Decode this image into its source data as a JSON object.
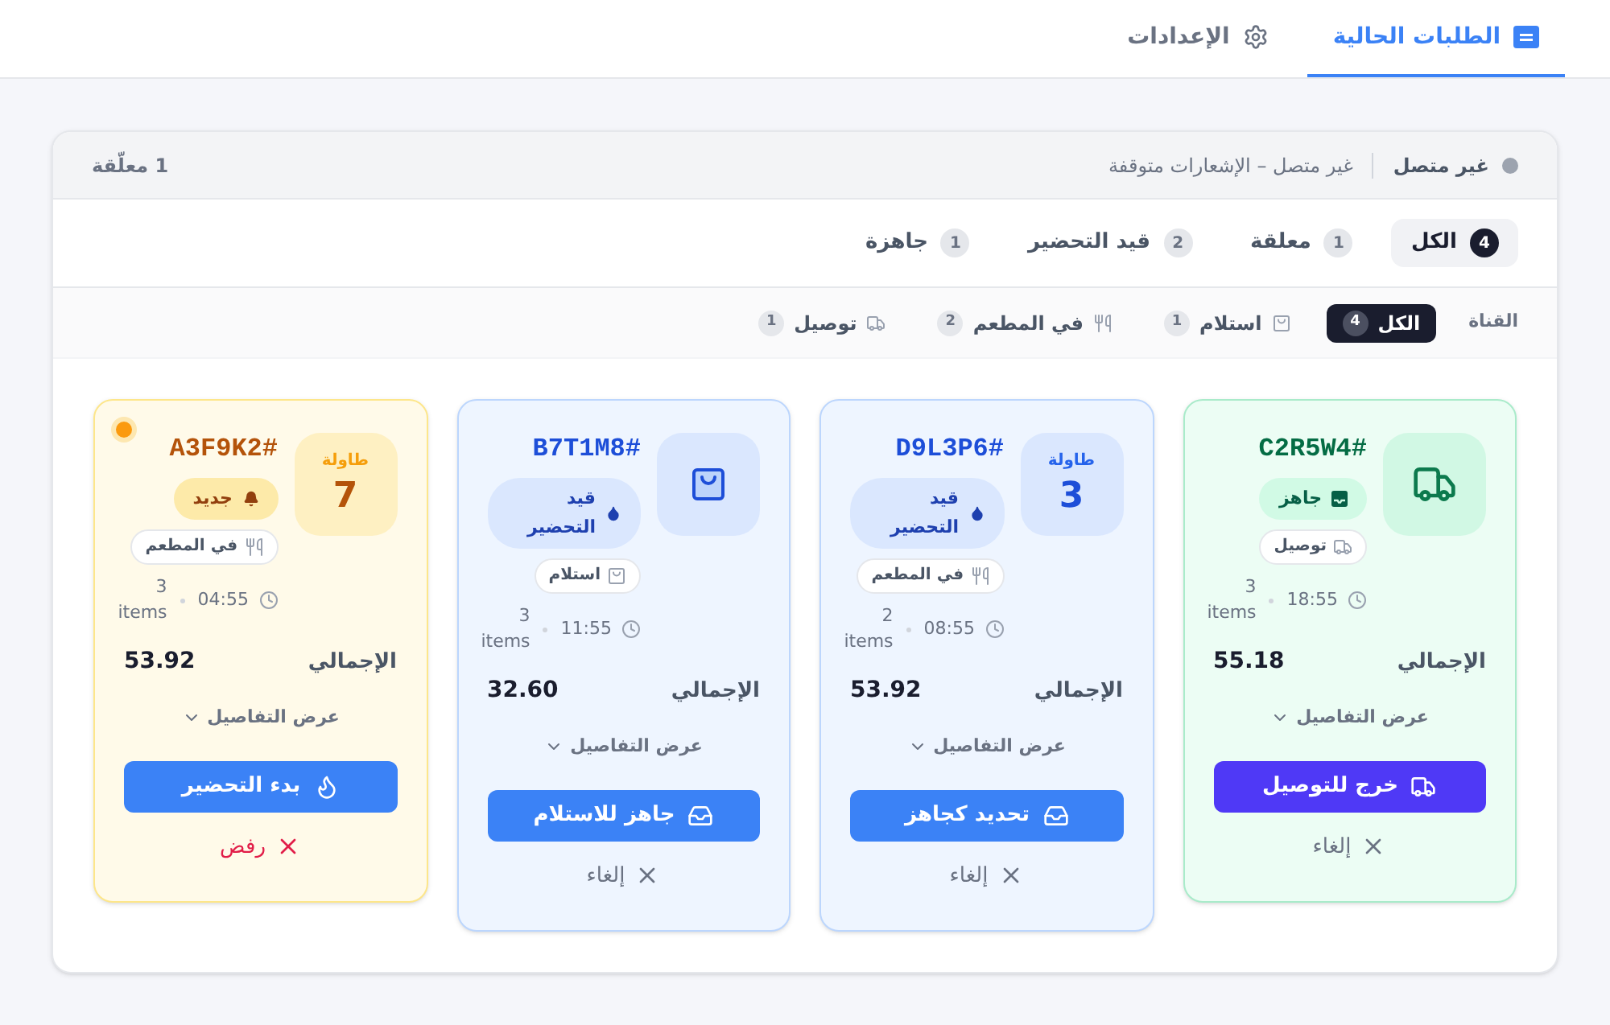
{
  "nav": {
    "tabs": [
      {
        "label": "الطلبات الحالية",
        "kind": "orders",
        "selected": true
      },
      {
        "label": "الإعدادات",
        "kind": "settings",
        "selected": false
      }
    ]
  },
  "panel": {
    "connection": {
      "online": false,
      "label": "غير متصل",
      "message": "غير متصل – الإشعارات متوقفة"
    },
    "pending_count": "1 معلّقة",
    "status_filters": [
      {
        "label": "الكل",
        "count": "4",
        "selected": true
      },
      {
        "label": "معلقة",
        "count": "1",
        "selected": false
      },
      {
        "label": "قيد التحضير",
        "count": "2",
        "selected": false
      },
      {
        "label": "جاهزة",
        "count": "1",
        "selected": false
      }
    ],
    "channel_filter": {
      "label": "القناة",
      "options": [
        {
          "label": "الكل",
          "count": "4",
          "kind": "all",
          "selected": true
        },
        {
          "label": "استلام",
          "count": "1",
          "kind": "pickup",
          "selected": false
        },
        {
          "label": "في المطعم",
          "count": "2",
          "kind": "dine_in",
          "selected": false
        },
        {
          "label": "توصيل",
          "count": "1",
          "kind": "delivery",
          "selected": false
        }
      ]
    },
    "orders": [
      {
        "code": "#C2R5W4",
        "unseen": false,
        "status": {
          "kind": "ready",
          "label": "جاهز"
        },
        "channel": {
          "kind": "delivery",
          "label": "توصيل"
        },
        "time": "18:55",
        "items": "3 items",
        "total_label": "الإجمالي",
        "total": "55.18",
        "details": "عرض التفاصيل",
        "action": {
          "kind": "dispatch",
          "label": "خرج للتوصيل"
        },
        "dismiss": {
          "kind": "cancel",
          "label": "إلغاء"
        }
      },
      {
        "code": "#D9L3P6",
        "unseen": false,
        "table": {
          "label": "طاولة",
          "number": "3"
        },
        "status": {
          "kind": "preparing",
          "label": "قيد التحضير"
        },
        "channel": {
          "kind": "dine_in",
          "label": "في المطعم"
        },
        "time": "08:55",
        "items": "2 items",
        "total_label": "الإجمالي",
        "total": "53.92",
        "details": "عرض التفاصيل",
        "action": {
          "kind": "mark_ready",
          "label": "تحديد كجاهز"
        },
        "dismiss": {
          "kind": "cancel",
          "label": "إلغاء"
        }
      },
      {
        "code": "#B7T1M8",
        "unseen": false,
        "status": {
          "kind": "preparing",
          "label": "قيد التحضير"
        },
        "channel": {
          "kind": "pickup",
          "label": "استلام"
        },
        "time": "11:55",
        "items": "3 items",
        "total_label": "الإجمالي",
        "total": "32.60",
        "details": "عرض التفاصيل",
        "action": {
          "kind": "pickup_ready",
          "label": "جاهز للاستلام"
        },
        "dismiss": {
          "kind": "cancel",
          "label": "إلغاء"
        }
      },
      {
        "code": "#A3F9K2",
        "unseen": true,
        "table": {
          "label": "طاولة",
          "number": "7"
        },
        "status": {
          "kind": "new",
          "label": "جديد"
        },
        "channel": {
          "kind": "dine_in",
          "label": "في المطعم"
        },
        "time": "04:55",
        "items": "3 items",
        "total_label": "الإجمالي",
        "total": "53.92",
        "details": "عرض التفاصيل",
        "action": {
          "kind": "start",
          "label": "بدء التحضير"
        },
        "dismiss": {
          "kind": "reject",
          "label": "رفض"
        }
      }
    ]
  }
}
